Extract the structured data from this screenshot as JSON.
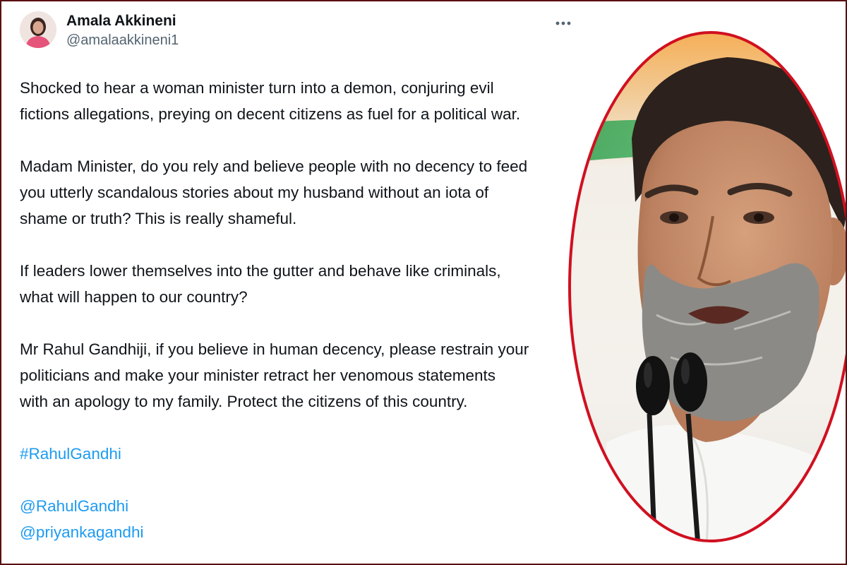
{
  "tweet": {
    "display_name": "Amala Akkineni",
    "handle": "@amalaakkineni1",
    "more_icon": "more-horizontal-icon",
    "paragraphs": [
      {
        "lines": [
          "Shocked to hear a woman minister turn into a demon, conjuring evil",
          "fictions allegations, preying on decent citizens as fuel for a political war."
        ]
      },
      {
        "lines": [
          "Madam Minister, do you rely and believe people with no decency to feed",
          "you utterly scandalous stories about my husband without an iota of",
          "shame or truth? This is really shameful."
        ]
      },
      {
        "lines": [
          "If leaders lower themselves into the gutter and behave like criminals,",
          "what will happen to our country?"
        ]
      },
      {
        "lines": [
          "Mr Rahul Gandhiji, if you believe in human decency, please restrain your",
          "politicians and make your minister retract her venomous statements",
          "with an apology to my family. Protect the citizens of this country."
        ]
      }
    ],
    "hashtag": "#RahulGandhi",
    "mentions": [
      "@RahulGandhi",
      "@priyankagandhi"
    ]
  },
  "colors": {
    "text": "#0f1419",
    "secondary": "#536471",
    "link": "#1d9bf0",
    "frame_border": "#5a0f12",
    "photo_ring": "#d01020"
  },
  "photo": {
    "subject": "man with grey beard speaking into microphones",
    "background": "saffron-white-green gradient"
  }
}
